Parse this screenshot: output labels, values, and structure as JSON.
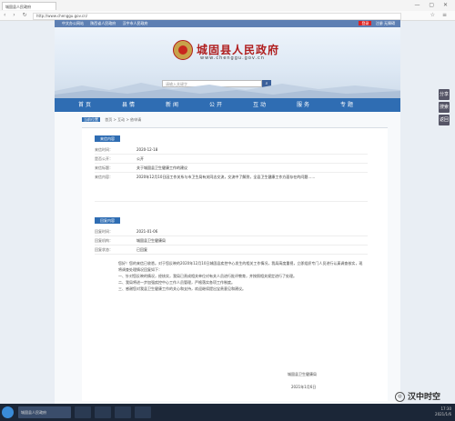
{
  "browser": {
    "tab_title": "城固县人民政府",
    "address": "http://www.chenggu.gov.cn/"
  },
  "site": {
    "top_links": [
      "中文办公网站",
      "陕西省人民政府",
      "汉中市人民政府"
    ],
    "top_right": [
      "登录",
      "注册",
      "无障碍"
    ],
    "title": "城固县人民政府",
    "url": "www.chenggu.gov.cn",
    "search_placeholder": "请输入关键字",
    "search_icon": "search-icon"
  },
  "nav": [
    "首 页",
    "县 情",
    "新 闻",
    "公 开",
    "互 动",
    "服 务",
    "专 题"
  ],
  "breadcrumb": {
    "home": "当前位置",
    "path": "首页 > 互动 > 依申请"
  },
  "letter": {
    "badge": "来信内容",
    "rows": [
      {
        "label": "来信时间：",
        "value": "2020-12-18"
      },
      {
        "label": "是否公开：",
        "value": "公开"
      },
      {
        "label": "来信标题：",
        "value": "关于城固县卫生健康工作的建议"
      },
      {
        "label": "来信内容：",
        "value": "2020年12月10日因工作关系与市卫生局有关同志交流，交流中了解到，全县卫生健康工作方面存在的问题……"
      }
    ]
  },
  "reply": {
    "badge": "回复内容",
    "rows": [
      {
        "label": "回复时间：",
        "value": "2021-01-06"
      },
      {
        "label": "回复机构：",
        "value": "城固县卫生健康局"
      },
      {
        "label": "回复状态：",
        "value": "已回复"
      }
    ],
    "paragraphs": [
      "您好！您的来信已收悉。对于您反映的2020年12月10日城固县疾控中心发生的相关工作情况，我局高度重视，立即组织专门人员进行认真调查核实，现将调查处理情况回复如下：",
      "一、针对您反映的情况，经核实，我局已责成相关单位对有关人员进行批评教育，并按照相关规定进行了处理。",
      "二、我局将进一步加强疾控中心工作人员管理，严格落实各项工作制度。",
      "三、感谢您对我县卫生健康工作的关心和支持，欢迎继续提出宝贵意见和建议。"
    ],
    "signature": "城固县卫生健康局",
    "date": "2021年1月6日"
  },
  "side_buttons": [
    "分享",
    "搜索",
    "返回"
  ],
  "watermark": "汉中时空",
  "taskbar": {
    "active_app": "城固县人民政府",
    "time": "17:30",
    "date": "2021/1/6"
  }
}
